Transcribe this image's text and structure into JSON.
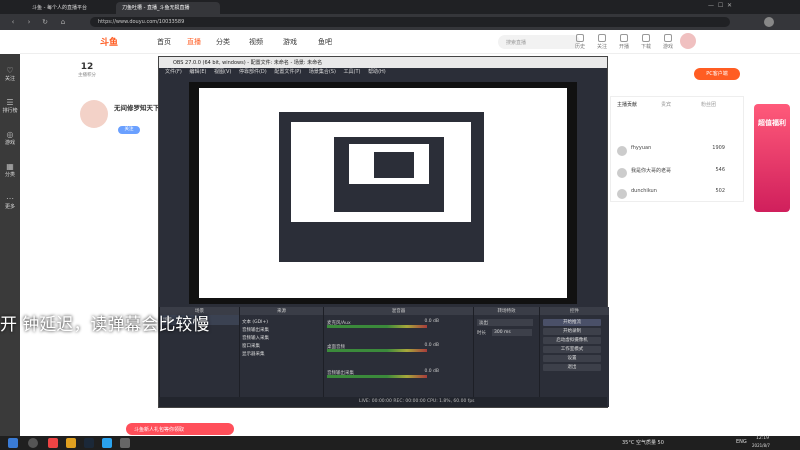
{
  "browser": {
    "tabs": [
      "斗鱼 - 每个人的直播平台",
      "刀鱼吐槽 - 直播_斗鱼无损直播"
    ],
    "url": "https://www.douyu.com/10033589"
  },
  "site": {
    "logo": "斗鱼",
    "nav": [
      "首页",
      "直播",
      "分类",
      "视频",
      "游戏",
      "鱼吧"
    ],
    "search_placeholder": "搜索直播",
    "top_icons": [
      "历史",
      "关注",
      "开播",
      "下载",
      "游戏"
    ],
    "sidebar": [
      "关注",
      "排行榜",
      "游戏",
      "分类",
      "更多"
    ],
    "level_num": "12",
    "level_label": "主播积分",
    "anchor_name": "无间修罗知天下",
    "follow_btn": "关注",
    "pc_client": "PC客户端",
    "rank_tabs": [
      "主播贡献",
      "贵宾",
      "粉丝团"
    ],
    "rank_rows": [
      {
        "name": "fhyyuan",
        "score": "1909"
      },
      {
        "name": "我是你大哥的老哥",
        "score": "546"
      },
      {
        "name": "dunchikun",
        "score": "502"
      }
    ],
    "ad_text": "超值福利",
    "banner": "斗鱼新人礼包等你领取"
  },
  "obs": {
    "title": "OBS 27.0.0 (64 bit, windows) - 配置文件: 未命名 - 场景: 未命名",
    "menu": [
      "文件(F)",
      "编辑(E)",
      "视图(V)",
      "停靠部件(D)",
      "配置文件(P)",
      "场景集合(S)",
      "工具(T)",
      "帮助(H)"
    ],
    "docks": {
      "scenes": "场景",
      "sources": "来源",
      "mixer": "混音器",
      "transitions": "转场特效",
      "controls": "控件"
    },
    "scene_name": "场景",
    "source_items": [
      "文本 (GDI+)",
      "音频输出采集",
      "音频输入采集",
      "窗口采集",
      "显示器采集"
    ],
    "mixer_items": [
      "麦克风/Aux",
      "桌面音频",
      "音频输出采集"
    ],
    "mixer_values": [
      "0.0 dB",
      "0.0 dB",
      "0.0 dB"
    ],
    "transition_name": "淡出",
    "transition_duration_label": "时长",
    "transition_duration": "300 ms",
    "controls": [
      "开始推流",
      "开始录制",
      "启动虚拟摄像机",
      "工作室模式",
      "设置",
      "退出"
    ],
    "status": "LIVE: 00:00:00   REC: 00:00:00   CPU: 1.8%, 60.00 fps"
  },
  "subtitle": "开    钟延迟，读弹幕会比较慢",
  "taskbar": {
    "weather": "35°C 空气质量 50",
    "lang": "ENG",
    "time": "12:19",
    "date": "2021/8/7"
  }
}
